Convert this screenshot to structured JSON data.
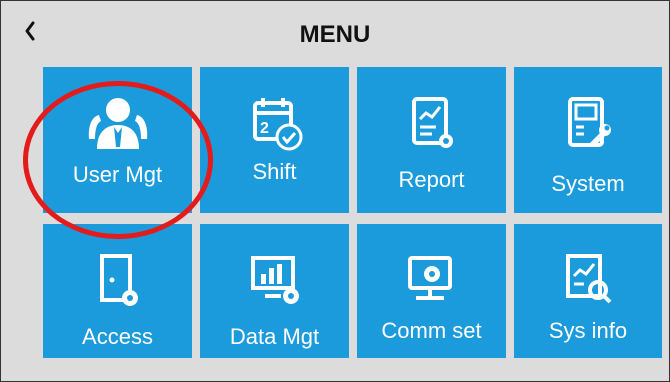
{
  "header": {
    "back_glyph": "<",
    "title": "MENU"
  },
  "tiles": [
    {
      "label": "User Mgt",
      "icon": "users-icon"
    },
    {
      "label": "Shift",
      "icon": "calendar-icon"
    },
    {
      "label": "Report",
      "icon": "report-icon"
    },
    {
      "label": "System",
      "icon": "system-icon"
    },
    {
      "label": "Access",
      "icon": "door-icon"
    },
    {
      "label": "Data Mgt",
      "icon": "data-icon"
    },
    {
      "label": "Comm set",
      "icon": "comm-icon"
    },
    {
      "label": "Sys info",
      "icon": "sys-info-icon"
    }
  ],
  "highlight": {
    "target": "User Mgt",
    "color": "#e41b1b"
  },
  "colors": {
    "tile": "#1b9bdb",
    "background": "#dcdcdc"
  }
}
